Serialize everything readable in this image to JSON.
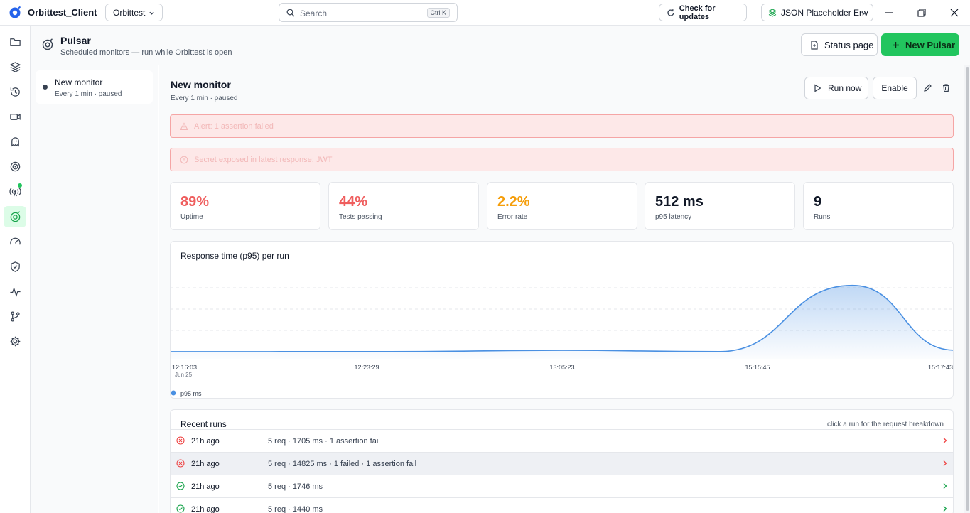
{
  "titlebar": {
    "app_name": "Orbittest_Client",
    "workspace": "Orbittest",
    "search_placeholder": "Search",
    "search_shortcut": "Ctrl K",
    "updates_label": "Check for updates",
    "environment": "JSON Placeholder Env"
  },
  "sidebar": {
    "items": [
      {
        "icon": "folder-icon"
      },
      {
        "icon": "layers-icon"
      },
      {
        "icon": "history-icon"
      },
      {
        "icon": "video-icon"
      },
      {
        "icon": "ghost-icon"
      },
      {
        "icon": "target-icon"
      },
      {
        "icon": "broadcast-icon",
        "badge": true
      },
      {
        "icon": "pulsar-icon",
        "active": true
      },
      {
        "icon": "gauge-icon"
      },
      {
        "icon": "shield-icon"
      },
      {
        "icon": "activity-icon"
      },
      {
        "icon": "git-branch-icon"
      },
      {
        "icon": "settings-icon"
      }
    ]
  },
  "header": {
    "title": "Pulsar",
    "subtitle": "Scheduled monitors — run while Orbittest is open",
    "status_page_label": "Status page",
    "new_pulsar_label": "New Pulsar"
  },
  "monitors": [
    {
      "name": "New monitor",
      "meta": "Every 1 min · paused"
    }
  ],
  "monitor": {
    "title": "New monitor",
    "subtitle": "Every 1 min · paused",
    "run_now_label": "Run now",
    "enable_label": "Enable"
  },
  "alerts": [
    {
      "text": "Alert: 1 assertion failed",
      "icon": "warning-icon"
    },
    {
      "text": "Secret exposed in latest response: JWT",
      "icon": "alert-circle-icon"
    }
  ],
  "kpis": [
    {
      "value": "89%",
      "label": "Uptime",
      "color": "#ef5e5e"
    },
    {
      "value": "44%",
      "label": "Tests passing",
      "color": "#ef5e5e"
    },
    {
      "value": "2.2%",
      "label": "Error rate",
      "color": "#f59e0b"
    },
    {
      "value": "512 ms",
      "label": "p95 latency",
      "color": "#111827"
    },
    {
      "value": "9",
      "label": "Runs",
      "color": "#111827"
    }
  ],
  "chart_data": {
    "type": "area",
    "title": "Response time (p95) per run",
    "x": [
      "12:16:03",
      "12:23:29",
      "13:05:23",
      "15:15:45",
      "15:17:43"
    ],
    "x_sub": [
      "Jun 25",
      "",
      "",
      "",
      ""
    ],
    "series": [
      {
        "name": "p95 ms",
        "values": [
          1440,
          1470,
          1705,
          1460,
          14825,
          1746
        ],
        "color": "#4a90e2"
      }
    ],
    "ylim": [
      0,
      16500
    ],
    "grid": true,
    "legend": "bottom-left"
  },
  "recent_runs": {
    "title": "Recent runs",
    "hint": "click a run for the request breakdown",
    "rows": [
      {
        "status": "fail",
        "ago": "21h ago",
        "details": "5 req · 1705 ms · 1 assertion fail"
      },
      {
        "status": "fail",
        "ago": "21h ago",
        "details": "5 req · 14825 ms · 1 failed · 1 assertion fail",
        "selected": true
      },
      {
        "status": "pass",
        "ago": "21h ago",
        "details": "5 req · 1746 ms"
      },
      {
        "status": "pass",
        "ago": "21h ago",
        "details": "5 req · 1440 ms"
      }
    ]
  }
}
